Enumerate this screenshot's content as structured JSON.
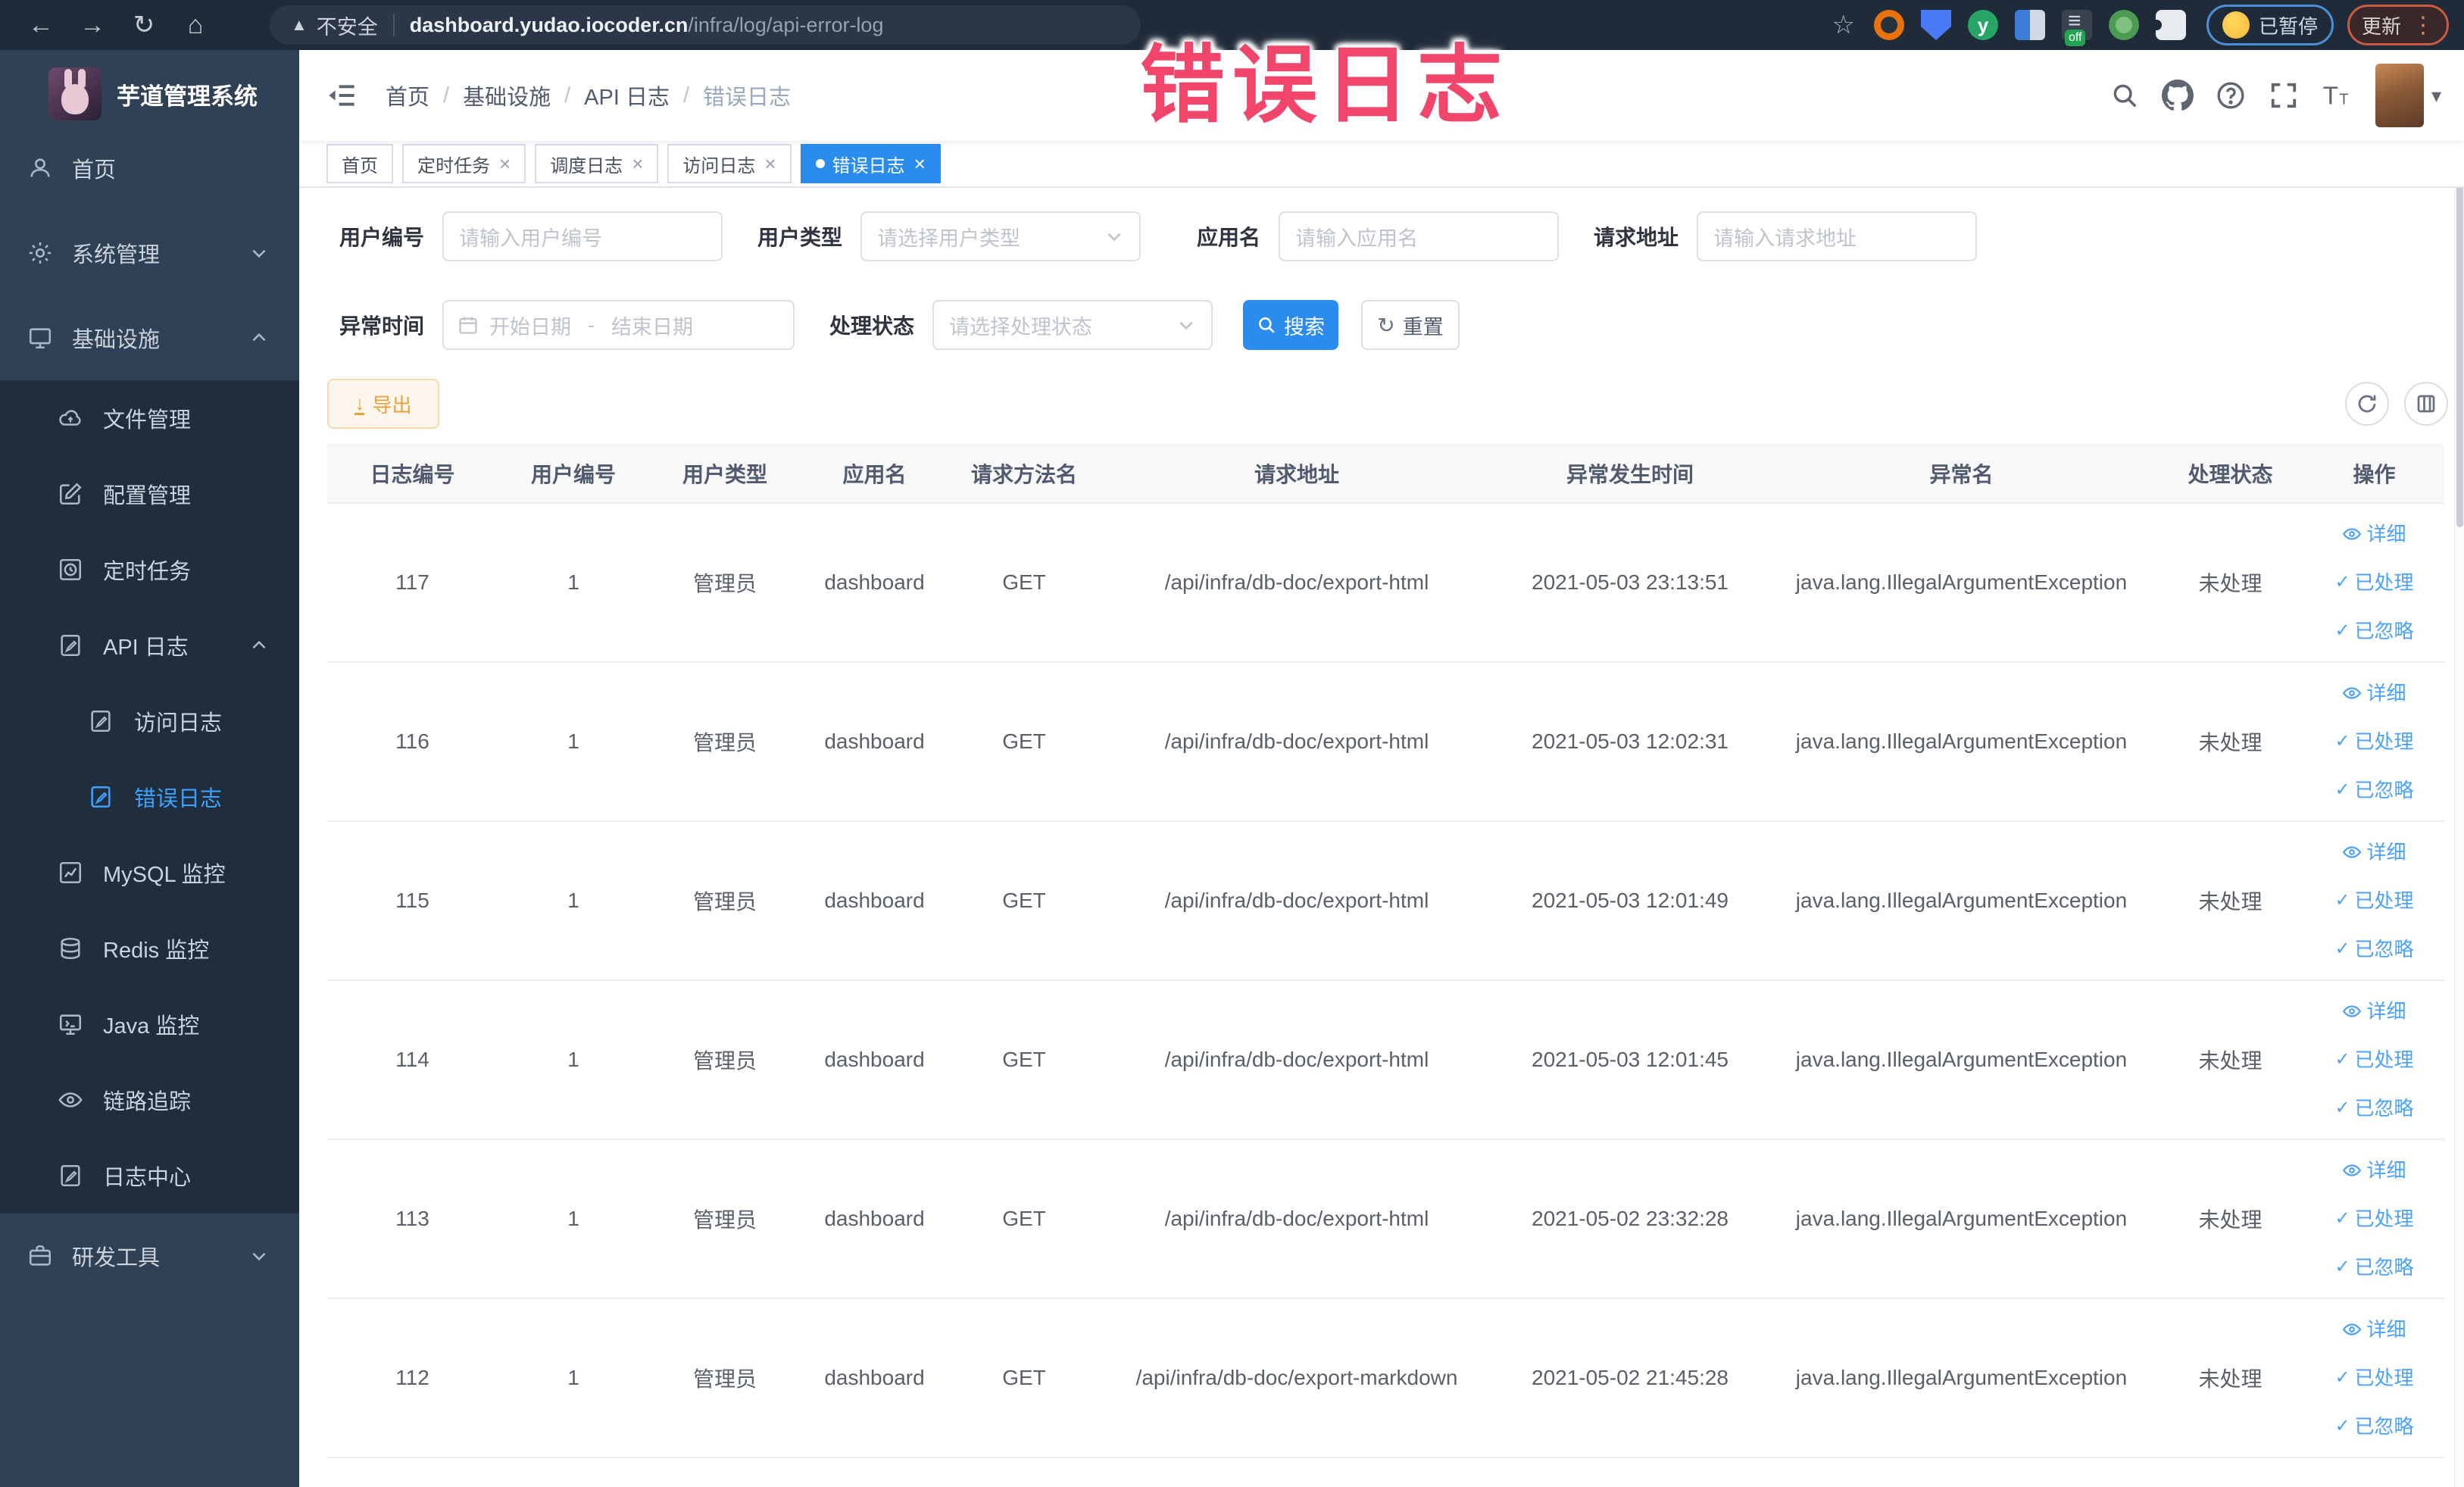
{
  "browser": {
    "security_label": "不安全",
    "url_host": "dashboard.yudao.iocoder.cn",
    "url_path": "/infra/log/api-error-log",
    "paused_pill": "已暂停",
    "update_pill": "更新"
  },
  "annotation": "错误日志",
  "sidebar": {
    "title": "芋道管理系统",
    "items": [
      {
        "key": "home",
        "label": "首页",
        "icon": "person",
        "level": 1
      },
      {
        "key": "system",
        "label": "系统管理",
        "icon": "gear",
        "level": 1,
        "arrow": "down"
      },
      {
        "key": "infra",
        "label": "基础设施",
        "icon": "monitor",
        "level": 1,
        "arrow": "up"
      },
      {
        "key": "file",
        "label": "文件管理",
        "icon": "cloud",
        "level": 2,
        "sub": true
      },
      {
        "key": "config",
        "label": "配置管理",
        "icon": "edit",
        "level": 2,
        "sub": true
      },
      {
        "key": "job",
        "label": "定时任务",
        "icon": "clock",
        "level": 2,
        "sub": true
      },
      {
        "key": "api-log",
        "label": "API 日志",
        "icon": "docedit",
        "level": 2,
        "sub": true,
        "arrow": "up"
      },
      {
        "key": "access-log",
        "label": "访问日志",
        "icon": "docedit",
        "level": 3,
        "sub": true
      },
      {
        "key": "error-log",
        "label": "错误日志",
        "icon": "docedit",
        "level": 3,
        "sub": true,
        "active": true
      },
      {
        "key": "mysql",
        "label": "MySQL 监控",
        "icon": "chart",
        "level": 2,
        "sub": true
      },
      {
        "key": "redis",
        "label": "Redis 监控",
        "icon": "layers",
        "level": 2,
        "sub": true
      },
      {
        "key": "java",
        "label": "Java 监控",
        "icon": "screen",
        "level": 2,
        "sub": true
      },
      {
        "key": "trace",
        "label": "链路追踪",
        "icon": "eye",
        "level": 2,
        "sub": true
      },
      {
        "key": "log-center",
        "label": "日志中心",
        "icon": "docedit",
        "level": 2,
        "sub": true
      },
      {
        "key": "dev-tools",
        "label": "研发工具",
        "icon": "briefcase",
        "level": 1,
        "arrow": "down"
      }
    ]
  },
  "breadcrumb": [
    "首页",
    "基础设施",
    "API 日志",
    "错误日志"
  ],
  "tabs": [
    {
      "label": "首页",
      "closable": false,
      "active": false
    },
    {
      "label": "定时任务",
      "closable": true,
      "active": false
    },
    {
      "label": "调度日志",
      "closable": true,
      "active": false
    },
    {
      "label": "访问日志",
      "closable": true,
      "active": false
    },
    {
      "label": "错误日志",
      "closable": true,
      "active": true
    }
  ],
  "filters": {
    "user_id": {
      "label": "用户编号",
      "placeholder": "请输入用户编号"
    },
    "user_type": {
      "label": "用户类型",
      "placeholder": "请选择用户类型"
    },
    "app_name": {
      "label": "应用名",
      "placeholder": "请输入应用名"
    },
    "request_url": {
      "label": "请求地址",
      "placeholder": "请输入请求地址"
    },
    "exception_time": {
      "label": "异常时间",
      "start_placeholder": "开始日期",
      "separator": "-",
      "end_placeholder": "结束日期"
    },
    "status": {
      "label": "处理状态",
      "placeholder": "请选择处理状态"
    },
    "search_label": "搜索",
    "reset_label": "重置"
  },
  "toolbar": {
    "export_label": "导出"
  },
  "table": {
    "columns": [
      "日志编号",
      "用户编号",
      "用户类型",
      "应用名",
      "请求方法名",
      "请求地址",
      "异常发生时间",
      "异常名",
      "处理状态",
      "操作"
    ],
    "rows": [
      {
        "id": "117",
        "user_id": "1",
        "user_type": "管理员",
        "app": "dashboard",
        "method": "GET",
        "url": "/api/infra/db-doc/export-html",
        "time": "2021-05-03 23:13:51",
        "exception": "java.lang.IllegalArgumentException",
        "status": "未处理"
      },
      {
        "id": "116",
        "user_id": "1",
        "user_type": "管理员",
        "app": "dashboard",
        "method": "GET",
        "url": "/api/infra/db-doc/export-html",
        "time": "2021-05-03 12:02:31",
        "exception": "java.lang.IllegalArgumentException",
        "status": "未处理"
      },
      {
        "id": "115",
        "user_id": "1",
        "user_type": "管理员",
        "app": "dashboard",
        "method": "GET",
        "url": "/api/infra/db-doc/export-html",
        "time": "2021-05-03 12:01:49",
        "exception": "java.lang.IllegalArgumentException",
        "status": "未处理"
      },
      {
        "id": "114",
        "user_id": "1",
        "user_type": "管理员",
        "app": "dashboard",
        "method": "GET",
        "url": "/api/infra/db-doc/export-html",
        "time": "2021-05-03 12:01:45",
        "exception": "java.lang.IllegalArgumentException",
        "status": "未处理"
      },
      {
        "id": "113",
        "user_id": "1",
        "user_type": "管理员",
        "app": "dashboard",
        "method": "GET",
        "url": "/api/infra/db-doc/export-html",
        "time": "2021-05-02 23:32:28",
        "exception": "java.lang.IllegalArgumentException",
        "status": "未处理"
      },
      {
        "id": "112",
        "user_id": "1",
        "user_type": "管理员",
        "app": "dashboard",
        "method": "GET",
        "url": "/api/infra/db-doc/export-markdown",
        "time": "2021-05-02 21:45:28",
        "exception": "java.lang.IllegalArgumentException",
        "status": "未处理"
      }
    ],
    "actions": [
      {
        "key": "detail",
        "label": "详细",
        "icon": "eye"
      },
      {
        "key": "processed",
        "label": "已处理",
        "icon": "check"
      },
      {
        "key": "ignored",
        "label": "已忽略",
        "icon": "check"
      }
    ]
  },
  "colors": {
    "primary": "#2b8cf0",
    "link": "#4da1f6",
    "sidebar_bg": "#304156",
    "submenu_bg": "#1f2d3d",
    "active_menu": "#3ea0ff",
    "warning": "#e6a23c",
    "annotation": "#f2456c"
  }
}
